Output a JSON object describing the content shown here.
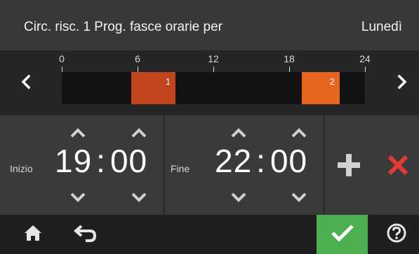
{
  "header": {
    "title": "Circ. risc. 1 Prog. fasce orarie per",
    "day": "Lunedì"
  },
  "timeline": {
    "scale_labels": [
      "0",
      "6",
      "12",
      "18",
      "24"
    ],
    "hours_total": 24,
    "bands": [
      {
        "label": "1",
        "start_hour": 5.5,
        "end_hour": 9.0,
        "color": "#c0441c"
      },
      {
        "label": "2",
        "start_hour": 19.0,
        "end_hour": 22.0,
        "color": "#e8651e"
      }
    ]
  },
  "start": {
    "label": "Inizio",
    "hours": "19",
    "minutes": "00"
  },
  "end": {
    "label": "Fine",
    "hours": "22",
    "minutes": "00"
  },
  "icons": {
    "prev": "chevron-left-icon",
    "next": "chevron-right-icon",
    "add": "plus-icon",
    "delete": "close-icon",
    "home": "home-icon",
    "back": "back-arrow-icon",
    "confirm": "check-icon",
    "help": "help-icon"
  },
  "colors": {
    "band_1": "#c0441c",
    "band_2": "#e8651e",
    "delete": "#e53935",
    "confirm": "#4caf50"
  }
}
